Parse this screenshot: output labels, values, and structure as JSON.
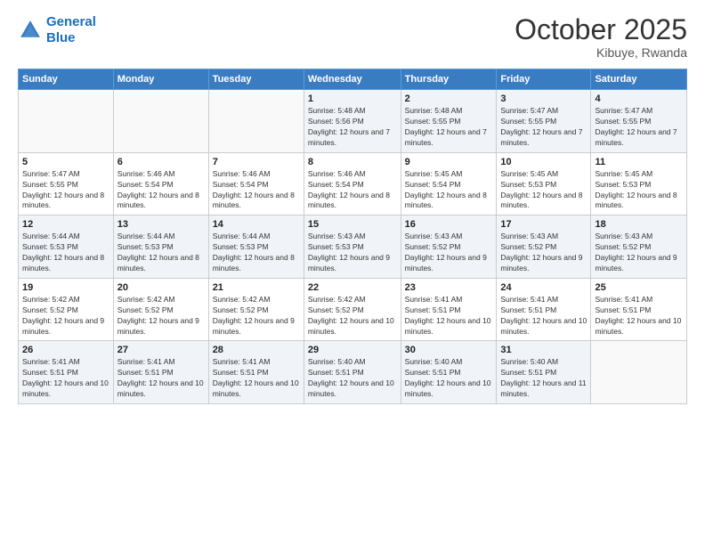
{
  "header": {
    "logo_line1": "General",
    "logo_line2": "Blue",
    "month": "October 2025",
    "location": "Kibuye, Rwanda"
  },
  "weekdays": [
    "Sunday",
    "Monday",
    "Tuesday",
    "Wednesday",
    "Thursday",
    "Friday",
    "Saturday"
  ],
  "weeks": [
    [
      {
        "day": "",
        "sunrise": "",
        "sunset": "",
        "daylight": ""
      },
      {
        "day": "",
        "sunrise": "",
        "sunset": "",
        "daylight": ""
      },
      {
        "day": "",
        "sunrise": "",
        "sunset": "",
        "daylight": ""
      },
      {
        "day": "1",
        "sunrise": "5:48 AM",
        "sunset": "5:56 PM",
        "daylight": "12 hours and 7 minutes."
      },
      {
        "day": "2",
        "sunrise": "5:48 AM",
        "sunset": "5:55 PM",
        "daylight": "12 hours and 7 minutes."
      },
      {
        "day": "3",
        "sunrise": "5:47 AM",
        "sunset": "5:55 PM",
        "daylight": "12 hours and 7 minutes."
      },
      {
        "day": "4",
        "sunrise": "5:47 AM",
        "sunset": "5:55 PM",
        "daylight": "12 hours and 7 minutes."
      }
    ],
    [
      {
        "day": "5",
        "sunrise": "5:47 AM",
        "sunset": "5:55 PM",
        "daylight": "12 hours and 8 minutes."
      },
      {
        "day": "6",
        "sunrise": "5:46 AM",
        "sunset": "5:54 PM",
        "daylight": "12 hours and 8 minutes."
      },
      {
        "day": "7",
        "sunrise": "5:46 AM",
        "sunset": "5:54 PM",
        "daylight": "12 hours and 8 minutes."
      },
      {
        "day": "8",
        "sunrise": "5:46 AM",
        "sunset": "5:54 PM",
        "daylight": "12 hours and 8 minutes."
      },
      {
        "day": "9",
        "sunrise": "5:45 AM",
        "sunset": "5:54 PM",
        "daylight": "12 hours and 8 minutes."
      },
      {
        "day": "10",
        "sunrise": "5:45 AM",
        "sunset": "5:53 PM",
        "daylight": "12 hours and 8 minutes."
      },
      {
        "day": "11",
        "sunrise": "5:45 AM",
        "sunset": "5:53 PM",
        "daylight": "12 hours and 8 minutes."
      }
    ],
    [
      {
        "day": "12",
        "sunrise": "5:44 AM",
        "sunset": "5:53 PM",
        "daylight": "12 hours and 8 minutes."
      },
      {
        "day": "13",
        "sunrise": "5:44 AM",
        "sunset": "5:53 PM",
        "daylight": "12 hours and 8 minutes."
      },
      {
        "day": "14",
        "sunrise": "5:44 AM",
        "sunset": "5:53 PM",
        "daylight": "12 hours and 8 minutes."
      },
      {
        "day": "15",
        "sunrise": "5:43 AM",
        "sunset": "5:53 PM",
        "daylight": "12 hours and 9 minutes."
      },
      {
        "day": "16",
        "sunrise": "5:43 AM",
        "sunset": "5:52 PM",
        "daylight": "12 hours and 9 minutes."
      },
      {
        "day": "17",
        "sunrise": "5:43 AM",
        "sunset": "5:52 PM",
        "daylight": "12 hours and 9 minutes."
      },
      {
        "day": "18",
        "sunrise": "5:43 AM",
        "sunset": "5:52 PM",
        "daylight": "12 hours and 9 minutes."
      }
    ],
    [
      {
        "day": "19",
        "sunrise": "5:42 AM",
        "sunset": "5:52 PM",
        "daylight": "12 hours and 9 minutes."
      },
      {
        "day": "20",
        "sunrise": "5:42 AM",
        "sunset": "5:52 PM",
        "daylight": "12 hours and 9 minutes."
      },
      {
        "day": "21",
        "sunrise": "5:42 AM",
        "sunset": "5:52 PM",
        "daylight": "12 hours and 9 minutes."
      },
      {
        "day": "22",
        "sunrise": "5:42 AM",
        "sunset": "5:52 PM",
        "daylight": "12 hours and 10 minutes."
      },
      {
        "day": "23",
        "sunrise": "5:41 AM",
        "sunset": "5:51 PM",
        "daylight": "12 hours and 10 minutes."
      },
      {
        "day": "24",
        "sunrise": "5:41 AM",
        "sunset": "5:51 PM",
        "daylight": "12 hours and 10 minutes."
      },
      {
        "day": "25",
        "sunrise": "5:41 AM",
        "sunset": "5:51 PM",
        "daylight": "12 hours and 10 minutes."
      }
    ],
    [
      {
        "day": "26",
        "sunrise": "5:41 AM",
        "sunset": "5:51 PM",
        "daylight": "12 hours and 10 minutes."
      },
      {
        "day": "27",
        "sunrise": "5:41 AM",
        "sunset": "5:51 PM",
        "daylight": "12 hours and 10 minutes."
      },
      {
        "day": "28",
        "sunrise": "5:41 AM",
        "sunset": "5:51 PM",
        "daylight": "12 hours and 10 minutes."
      },
      {
        "day": "29",
        "sunrise": "5:40 AM",
        "sunset": "5:51 PM",
        "daylight": "12 hours and 10 minutes."
      },
      {
        "day": "30",
        "sunrise": "5:40 AM",
        "sunset": "5:51 PM",
        "daylight": "12 hours and 10 minutes."
      },
      {
        "day": "31",
        "sunrise": "5:40 AM",
        "sunset": "5:51 PM",
        "daylight": "12 hours and 11 minutes."
      },
      {
        "day": "",
        "sunrise": "",
        "sunset": "",
        "daylight": ""
      }
    ]
  ]
}
